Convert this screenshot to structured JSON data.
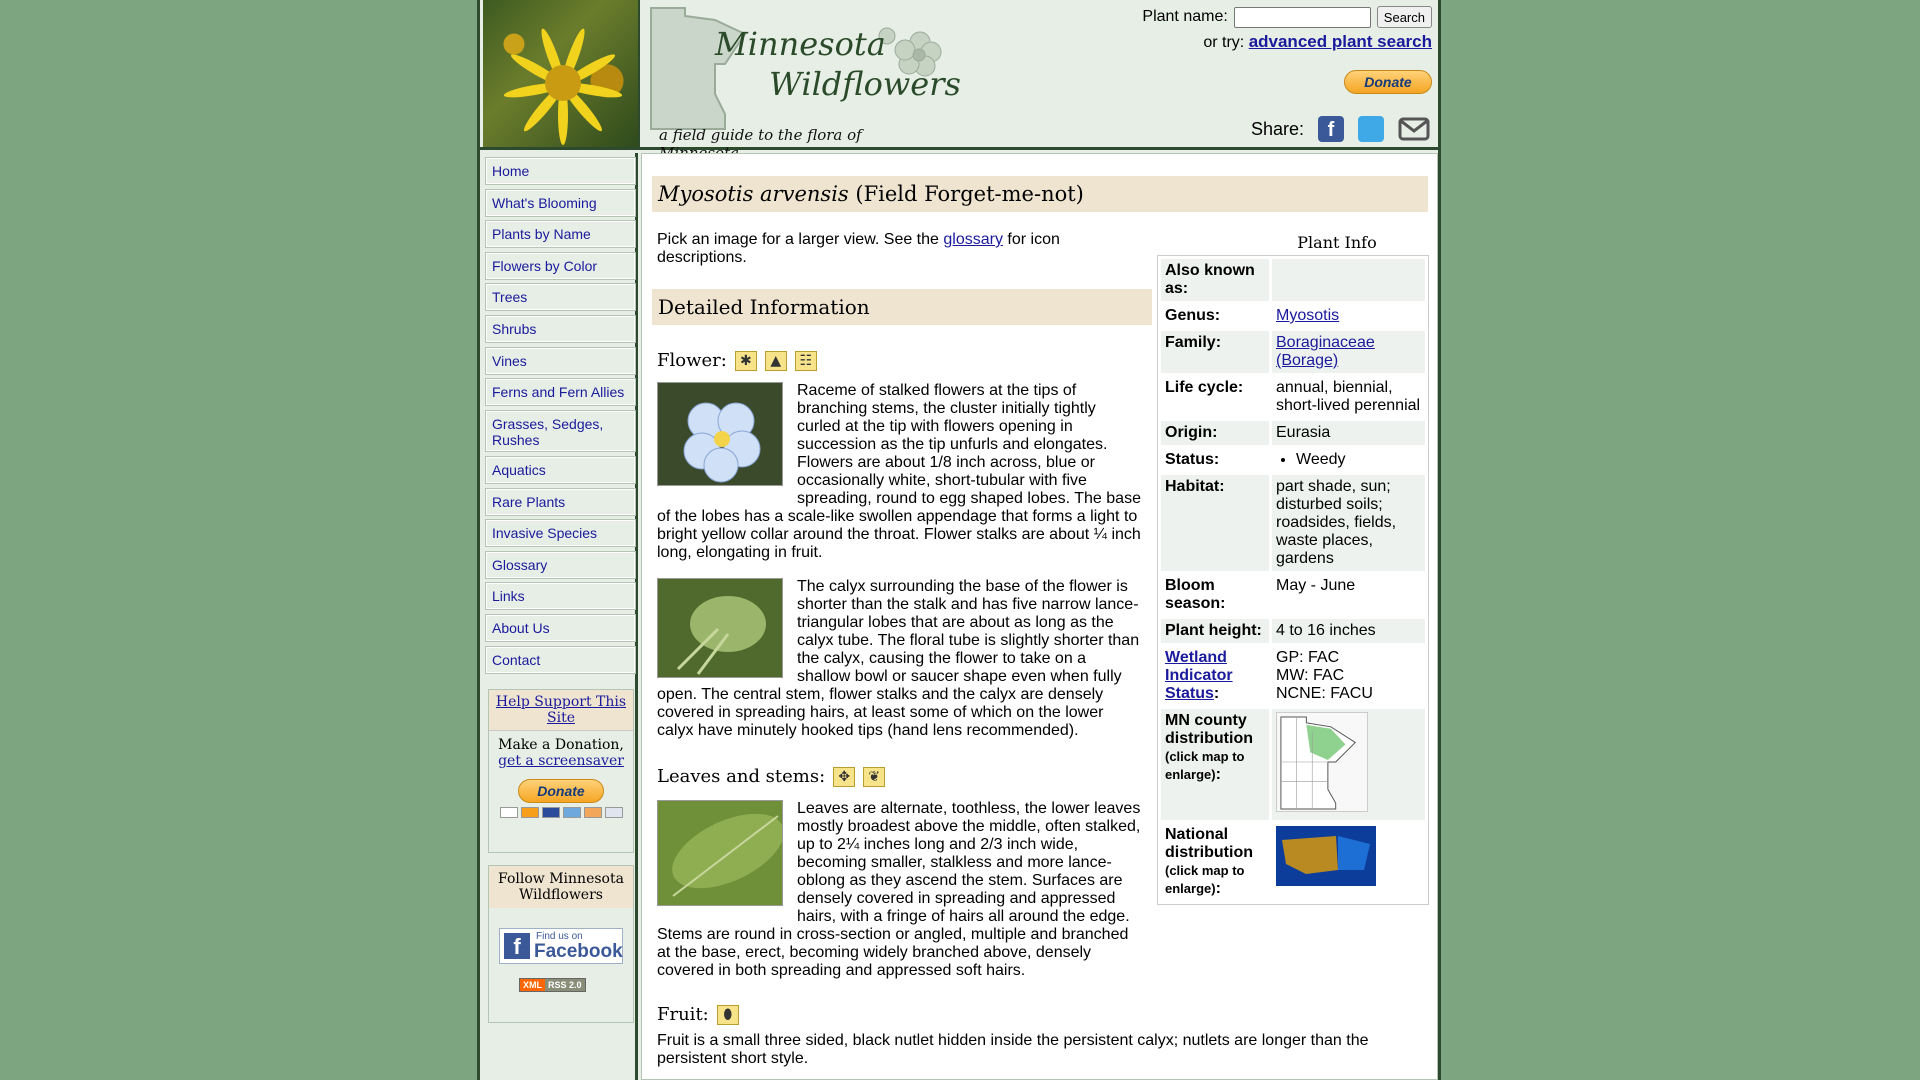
{
  "header": {
    "logo_line1": "Minnesota",
    "logo_line2": "Wildflowers",
    "tagline": "a field guide to the flora of Minnesota",
    "search_label": "Plant name:",
    "search_placeholder": "",
    "search_button": "Search",
    "try_prefix": "or try:",
    "try_link": "advanced plant search",
    "donate": "Donate",
    "share_label": "Share:"
  },
  "sidebar": {
    "items": [
      {
        "label": "Home"
      },
      {
        "label": "What's Blooming"
      },
      {
        "label": "Plants by Name"
      },
      {
        "label": "Flowers by Color"
      },
      {
        "label": "Trees"
      },
      {
        "label": "Shrubs"
      },
      {
        "label": "Vines"
      },
      {
        "label": "Ferns and Fern Allies"
      },
      {
        "label": "Grasses, Sedges, Rushes"
      },
      {
        "label": "Aquatics"
      },
      {
        "label": "Rare Plants"
      },
      {
        "label": "Invasive Species"
      },
      {
        "label": "Glossary"
      },
      {
        "label": "Links"
      },
      {
        "label": "About Us"
      },
      {
        "label": "Contact"
      }
    ],
    "support_head": "Help Support This Site",
    "support_text": "Make a Donation,",
    "support_link": "get a screensaver",
    "donate": "Donate",
    "follow_head": "Follow Minnesota Wildflowers",
    "fb_line1": "Find us on",
    "fb_line2": "Facebook",
    "rss_a": "XML",
    "rss_b": "RSS 2.0"
  },
  "main": {
    "sci_name": "Myosotis arvensis",
    "common_name": "(Field Forget-me-not)",
    "intro_before": "Pick an image for a larger view. See the",
    "intro_link": "glossary",
    "intro_after": "for icon descriptions.",
    "detail_head": "Detailed Information",
    "flower_head": "Flower:",
    "flower_text": "Raceme of stalked flowers at the tips of branching stems, the cluster initially tightly curled at the tip with flowers opening in succession as the tip unfurls and elongates. Flowers are about 1/8 inch across, blue or occasionally white, short-tubular with five spreading, round to egg shaped lobes. The base of the lobes has a scale-like swollen appendage that forms a light to bright yellow collar around the throat. Flower stalks are about ¼ inch long, elongating in fruit.",
    "calyx_text": "The calyx surrounding the base of the flower is shorter than the stalk and has five narrow lance-triangular lobes that are about as long as the calyx tube. The floral tube is slightly shorter than the calyx, causing the flower to take on a shallow bowl or saucer shape even when fully open. The central stem, flower stalks and the calyx are densely covered in spreading hairs, at least some of which on the lower calyx have minutely hooked tips (hand lens recommended).",
    "leaves_head": "Leaves and stems:",
    "leaves_text": "Leaves are alternate, toothless, the lower leaves mostly broadest above the middle, often stalked, up to 2¼ inches long and 2/3 inch wide, becoming smaller, stalkless and more lance-oblong as they ascend the stem. Surfaces are densely covered in spreading and appressed hairs, with a fringe of hairs all around the edge. Stems are round in cross-section or angled, multiple and branched at the base, erect, becoming widely branched above, densely covered in both spreading and appressed soft hairs.",
    "fruit_head": "Fruit:",
    "fruit_text": "Fruit is a small three sided, black nutlet hidden inside the persistent calyx; nutlets are longer than the persistent short style."
  },
  "info": {
    "caption": "Plant Info",
    "aka_label": "Also known as:",
    "aka_value": "",
    "genus_label": "Genus:",
    "genus_value": "Myosotis",
    "family_label": "Family:",
    "family_value": "Boraginaceae (Borage)",
    "life_label": "Life cycle:",
    "life_value": "annual, biennial, short-lived perennial",
    "origin_label": "Origin:",
    "origin_value": "Eurasia",
    "status_label": "Status:",
    "status_value": "Weedy",
    "habitat_label": "Habitat:",
    "habitat_value": "part shade, sun; disturbed soils; roadsides, fields, waste places, gardens",
    "bloom_label": "Bloom season:",
    "bloom_value": "May - June",
    "height_label": "Plant height:",
    "height_value": "4 to 16 inches",
    "wetland_label": "Wetland Indicator Status",
    "wetland_gp": "GP: FAC",
    "wetland_mw": "MW: FAC",
    "wetland_ncne": "NCNE: FACU",
    "mn_label": "MN county distribution",
    "national_label": "National distribution",
    "enlarge": "(click map to enlarge)"
  }
}
